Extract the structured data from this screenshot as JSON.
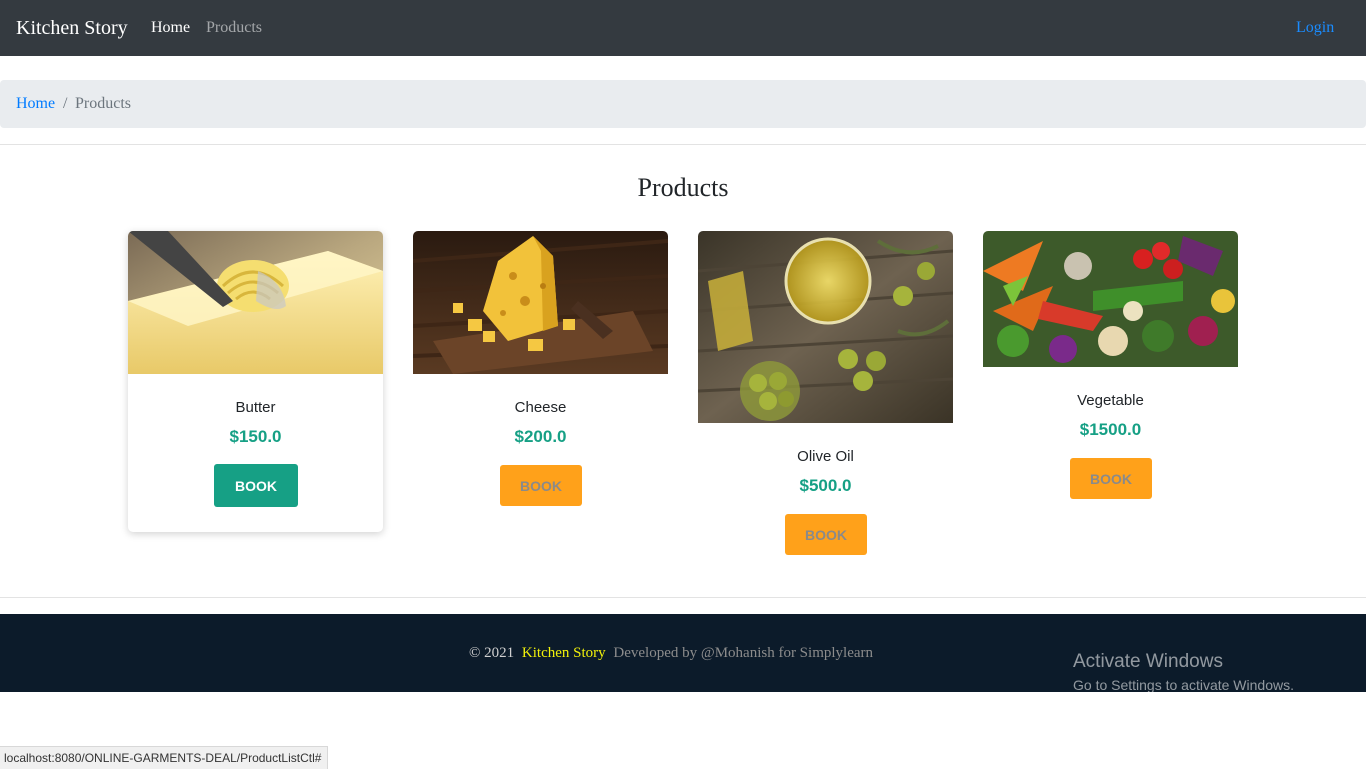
{
  "navbar": {
    "brand": "Kitchen Story",
    "links": [
      {
        "label": "Home"
      },
      {
        "label": "Products"
      }
    ],
    "login_label": "Login"
  },
  "breadcrumb": {
    "home": "Home",
    "separator": "/",
    "current": "Products"
  },
  "main": {
    "title": "Products",
    "products": [
      {
        "name": "Butter",
        "price": "$150.0",
        "button": "BOOK",
        "image": "butter-image"
      },
      {
        "name": "Cheese",
        "price": "$200.0",
        "button": "BOOK",
        "image": "cheese-image"
      },
      {
        "name": "Olive Oil",
        "price": "$500.0",
        "button": "BOOK",
        "image": "olive-oil-image"
      },
      {
        "name": "Vegetable",
        "price": "$1500.0",
        "button": "BOOK",
        "image": "vegetable-image"
      }
    ]
  },
  "footer": {
    "copyright": "© 2021",
    "brand": "Kitchen Story",
    "developer": "Developed by @Mohanish for Simplylearn"
  },
  "windows_watermark": {
    "title": "Activate Windows",
    "subtitle": "Go to Settings to activate Windows."
  },
  "status_bar": {
    "url": "localhost:8080/ONLINE-GARMENTS-DEAL/ProductListCtl#"
  },
  "colors": {
    "navbar_bg": "#343a40",
    "accent_green": "#16a085",
    "button_orange": "#ffa11a",
    "footer_bg": "#0c1b2a",
    "footer_brand": "#f1f10a"
  }
}
